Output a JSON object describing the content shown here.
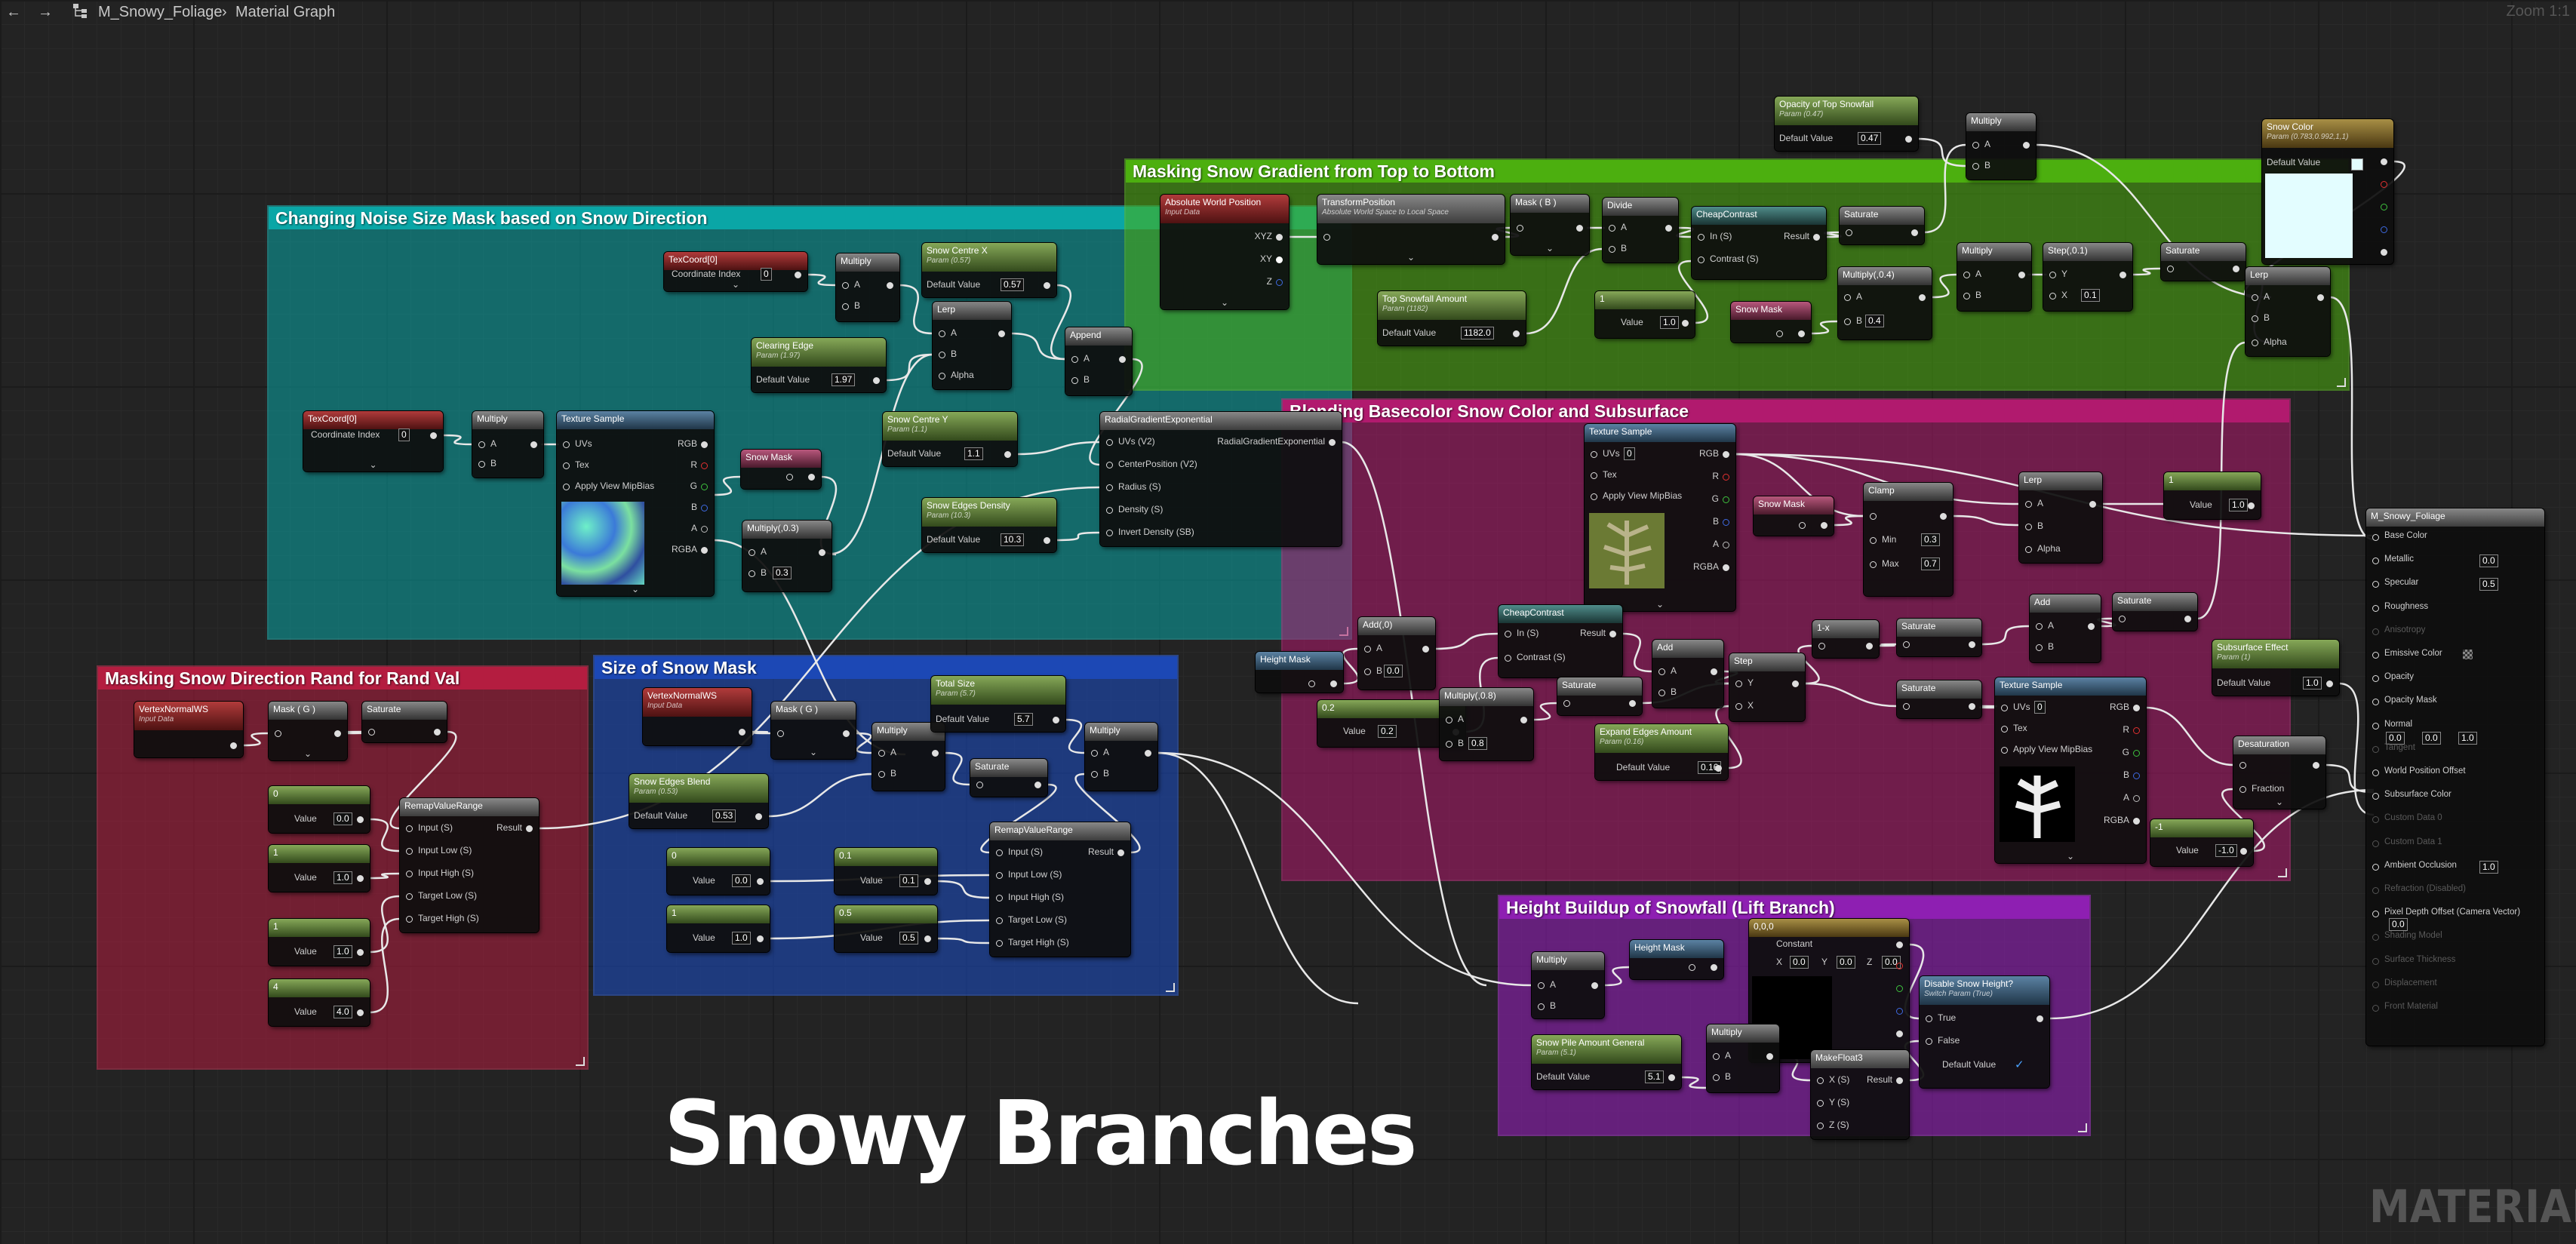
{
  "breadcrumb": {
    "asset": "M_Snowy_Foliage",
    "graph": "Material Graph"
  },
  "zoom": "Zoom 1:1",
  "title": "Snowy Branches",
  "watermark": "MATERIAL",
  "icons": {
    "back": "arrow-left-icon",
    "forward": "arrow-right-icon",
    "hierarchy": "hierarchy-icon",
    "separator": "chevron-right-icon"
  },
  "colors": {
    "teal": "#0aa6a6",
    "green": "#4caf0f",
    "magenta": "#b11a6e",
    "crimson": "#b41d40",
    "blue": "#1c48b5",
    "purple": "#8e1fb2",
    "background": "#232323"
  },
  "comments": {
    "c1": "Changing Noise Size Mask based on Snow Direction",
    "c2": "Masking Snow Gradient from Top to Bottom",
    "c3": "Blending Basecolor Snow Color and Subsurface",
    "c4": "Masking Snow Direction Rand for Rand Val",
    "c5": "Size of Snow Mask",
    "c6": "Height Buildup of Snowfall (Lift Branch)"
  },
  "nodes": {
    "texcoord0a": {
      "title": "TexCoord[0]",
      "l1": "Coordinate Index",
      "v1": "0"
    },
    "texcoord0b": {
      "title": "TexCoord[0]",
      "l1": "Coordinate Index",
      "v1": "0"
    },
    "mult_a": {
      "title": "Multiply",
      "a": "A",
      "b": "B"
    },
    "texsample1": {
      "title": "Texture Sample",
      "uvs": "UVs",
      "tex": "Tex",
      "mip": "Apply View MipBias",
      "rgb": "RGB",
      "r": "R",
      "g": "G",
      "b": "B",
      "a": "A",
      "rgba": "RGBA"
    },
    "snowmask1": {
      "title": "Snow Mask"
    },
    "multiply03": {
      "title": "Multiply(,0.3)",
      "a": "A",
      "b": "B",
      "v": "0.3"
    },
    "mult_b": {
      "title": "Multiply",
      "a": "A",
      "b": "B"
    },
    "clearingedge": {
      "title": "Clearing Edge",
      "sub": "Param (1.97)",
      "l": "Default Value",
      "v": "1.97"
    },
    "lerp1": {
      "title": "Lerp",
      "a": "A",
      "b": "B",
      "alpha": "Alpha"
    },
    "snowcentrex": {
      "title": "Snow Centre X",
      "sub": "Param (0.57)",
      "l": "Default Value",
      "v": "0.57"
    },
    "append": {
      "title": "Append",
      "a": "A",
      "b": "B"
    },
    "snowcentrey": {
      "title": "Snow Centre Y",
      "sub": "Param (1.1)",
      "l": "Default Value",
      "v": "1.1"
    },
    "snowedgesdensity": {
      "title": "Snow Edges Density",
      "sub": "Param (10.3)",
      "l": "Default Value",
      "v": "10.3"
    },
    "radgrad": {
      "title": "RadialGradientExponential",
      "out": "RadialGradientExponential",
      "uvs": "UVs (V2)",
      "cp": "CenterPosition (V2)",
      "rad": "Radius (S)",
      "den": "Density (S)",
      "inv": "Invert Density (SB)"
    },
    "absworld": {
      "title": "Absolute World Position",
      "sub": "Input Data",
      "xyz": "XYZ",
      "xy": "XY",
      "z": "Z"
    },
    "transformpos": {
      "title": "TransformPosition",
      "sub": "Absolute World Space to Local Space"
    },
    "mask_b": {
      "title": "Mask ( B )"
    },
    "divide": {
      "title": "Divide",
      "a": "A",
      "b": "B"
    },
    "cheapcontrast1": {
      "title": "CheapContrast",
      "ins": "In (S)",
      "res": "Result",
      "con": "Contrast (S)"
    },
    "saturate1": {
      "title": "Saturate"
    },
    "opacitytop": {
      "title": "Opacity of Top Snowfall",
      "sub": "Param (0.47)",
      "l": "Default Value",
      "v": "0.47"
    },
    "multiply_top": {
      "title": "Multiply",
      "a": "A",
      "b": "B"
    },
    "snowcolor": {
      "title": "Snow Color",
      "sub": "Param (0.783,0.992,1,1)",
      "l": "Default Value"
    },
    "topsnowfall": {
      "title": "Top Snowfall Amount",
      "sub": "Param (1182)",
      "l": "Default Value",
      "v": "1182.0"
    },
    "const1": {
      "title": "1",
      "l": "Value",
      "v": "1.0"
    },
    "snowmask2": {
      "title": "Snow Mask"
    },
    "multiply04": {
      "title": "Multiply(,0.4)",
      "a": "A",
      "b": "B",
      "v": "0.4"
    },
    "multiply_c": {
      "title": "Multiply",
      "a": "A",
      "b": "B"
    },
    "step01": {
      "title": "Step(,0.1)",
      "y": "Y",
      "x": "X",
      "v": "0.1"
    },
    "saturate2": {
      "title": "Saturate"
    },
    "lerp_top": {
      "title": "Lerp",
      "a": "A",
      "b": "B",
      "alpha": "Alpha"
    },
    "texsample2": {
      "title": "Texture Sample",
      "uvs": "UVs",
      "uv0": "0",
      "tex": "Tex",
      "mip": "Apply View MipBias",
      "rgb": "RGB",
      "r": "R",
      "g": "G",
      "b": "B",
      "a": "A",
      "rgba": "RGBA"
    },
    "snowmask3": {
      "title": "Snow Mask"
    },
    "clamp": {
      "title": "Clamp",
      "min": "Min",
      "minv": "0.3",
      "max": "Max",
      "maxv": "0.7"
    },
    "lerp2": {
      "title": "Lerp",
      "a": "A",
      "b": "B",
      "alpha": "Alpha"
    },
    "const1b": {
      "title": "1",
      "l": "Value",
      "v": "1.0"
    },
    "heightmask1": {
      "title": "Height Mask"
    },
    "add_n": {
      "title": "Add(,0)",
      "a": "A",
      "b": "B",
      "v": "0.0"
    },
    "const02": {
      "title": "0.2",
      "l": "Value",
      "v": "0.2"
    },
    "cheapcontrast2": {
      "title": "CheapContrast",
      "ins": "In (S)",
      "res": "Result",
      "con": "Contrast (S)"
    },
    "multiply08": {
      "title": "Multiply(,0.8)",
      "a": "A",
      "b": "B",
      "v": "0.8"
    },
    "saturate3": {
      "title": "Saturate"
    },
    "add2": {
      "title": "Add",
      "a": "A",
      "b": "B"
    },
    "step2": {
      "title": "Step",
      "y": "Y",
      "x": "X"
    },
    "oneminus": {
      "title": "1-x"
    },
    "saturate4": {
      "title": "Saturate"
    },
    "saturate5": {
      "title": "Saturate"
    },
    "add3": {
      "title": "Add",
      "a": "A",
      "b": "B"
    },
    "saturate6": {
      "title": "Saturate"
    },
    "expandedges": {
      "title": "Expand Edges Amount",
      "sub": "Param (0.16)",
      "l": "Default Value",
      "v": "0.16"
    },
    "texsample3": {
      "title": "Texture Sample",
      "uvs": "UVs",
      "uv0": "0",
      "tex": "Tex",
      "mip": "Apply View MipBias",
      "rgb": "RGB",
      "r": "R",
      "g": "G",
      "b": "B",
      "a": "A",
      "rgba": "RGBA"
    },
    "subsurface": {
      "title": "Subsurface Effect",
      "sub": "Param (1)",
      "l": "Default Value",
      "v": "1.0"
    },
    "desaturation": {
      "title": "Desaturation",
      "fraction": "Fraction"
    },
    "constneg1": {
      "title": "-1",
      "l": "Value",
      "v": "-1.0"
    },
    "vnormal1": {
      "title": "VertexNormalWS",
      "sub": "Input Data"
    },
    "mask_g1": {
      "title": "Mask ( G )"
    },
    "saturate7": {
      "title": "Saturate"
    },
    "c0a": {
      "title": "0",
      "l": "Value",
      "v": "0.0"
    },
    "c1a": {
      "title": "1",
      "l": "Value",
      "v": "1.0"
    },
    "c1b": {
      "title": "1",
      "l": "Value",
      "v": "1.0"
    },
    "c4": {
      "title": "4",
      "l": "Value",
      "v": "4.0"
    },
    "remap1": {
      "title": "RemapValueRange",
      "in": "Input (S)",
      "res": "Result",
      "il": "Input Low (S)",
      "ih": "Input High (S)",
      "tl": "Target Low (S)",
      "th": "Target High (S)"
    },
    "vnormal2": {
      "title": "VertexNormalWS",
      "sub": "Input Data"
    },
    "mask_g2": {
      "title": "Mask ( G )"
    },
    "multiply_d": {
      "title": "Multiply",
      "a": "A",
      "b": "B"
    },
    "totalsize": {
      "title": "Total Size",
      "sub": "Param (5.7)",
      "l": "Default Value",
      "v": "5.7"
    },
    "multiply_e": {
      "title": "Multiply",
      "a": "A",
      "b": "B"
    },
    "snowedgesblend": {
      "title": "Snow Edges Blend",
      "sub": "Param (0.53)",
      "l": "Default Value",
      "v": "0.53"
    },
    "saturate8": {
      "title": "Saturate"
    },
    "c0b": {
      "title": "0",
      "l": "Value",
      "v": "0.0"
    },
    "c01": {
      "title": "0.1",
      "l": "Value",
      "v": "0.1"
    },
    "c1c": {
      "title": "1",
      "l": "Value",
      "v": "1.0"
    },
    "c05": {
      "title": "0.5",
      "l": "Value",
      "v": "0.5"
    },
    "remap2": {
      "title": "RemapValueRange",
      "in": "Input (S)",
      "res": "Result",
      "il": "Input Low (S)",
      "ih": "Input High (S)",
      "tl": "Target Low (S)",
      "th": "Target High (S)"
    },
    "multiply_f": {
      "title": "Multiply",
      "a": "A",
      "b": "B"
    },
    "heightmask2": {
      "title": "Height Mask"
    },
    "const000": {
      "title": "0,0,0",
      "l": "Constant",
      "x": "X",
      "xv": "0.0",
      "y": "Y",
      "yv": "0.0",
      "z": "Z",
      "zv": "0.0"
    },
    "snowpile": {
      "title": "Snow Pile Amount General",
      "sub": "Param (5.1)",
      "l": "Default Value",
      "v": "5.1"
    },
    "multiply_g": {
      "title": "Multiply",
      "a": "A",
      "b": "B"
    },
    "makefloat3": {
      "title": "MakeFloat3",
      "x": "X (S)",
      "y": "Y (S)",
      "z": "Z (S)",
      "res": "Result"
    },
    "disablesnow": {
      "title": "Disable Snow Height?",
      "sub": "Switch Param (True)",
      "t": "True",
      "f": "False",
      "l": "Default Value"
    }
  },
  "material": {
    "title": "M_Snowy_Foliage",
    "pins": [
      "Base Color",
      "Metallic",
      "Specular",
      "Roughness",
      "Anisotropy",
      "Emissive Color",
      "Opacity",
      "Opacity Mask",
      "Normal",
      "Tangent",
      "World Position Offset",
      "Subsurface Color",
      "Custom Data 0",
      "Custom Data 1",
      "Ambient Occlusion",
      "Refraction (Disabled)",
      "Pixel Depth Offset (Camera Vector)",
      "Shading Model",
      "Surface Thickness",
      "Displacement",
      "Front Material"
    ],
    "metallic": "0.0",
    "specular": "0.5",
    "ao": "1.0",
    "normal_x": "0.0",
    "normal_y": "0.0",
    "normal_z": "1.0",
    "pdo": "0.0"
  }
}
